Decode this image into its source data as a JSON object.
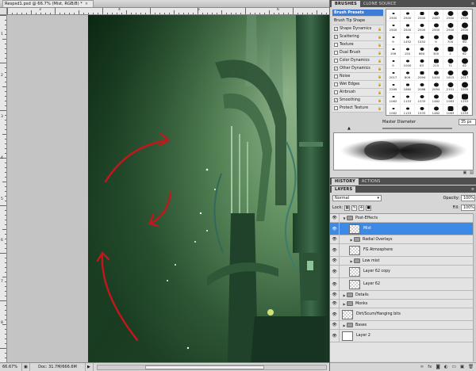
{
  "document": {
    "tab_title": "Respsd1.psd @ 66.7% (Mist, RGB/8) *",
    "close_glyph": "×",
    "ruler_top_labels": [
      "3",
      "4",
      "5",
      "6"
    ],
    "ruler_left_labels": [
      "1",
      "2",
      "3",
      "4",
      "5",
      "6",
      "7",
      "8"
    ],
    "status": {
      "zoom": "66.67%",
      "doc_size": "Doc: 31.7M/666.6M",
      "arrow_left": "◀",
      "arrow_right": "▶"
    }
  },
  "brushes_panel": {
    "tabs": [
      "BRUSHES",
      "CLONE SOURCE"
    ],
    "menu_glyph": "≡",
    "options": [
      {
        "label": "Brush Presets",
        "type": "preset"
      },
      {
        "label": "Brush Tip Shape",
        "type": "tip"
      },
      {
        "label": "Shape Dynamics",
        "checked": true
      },
      {
        "label": "Scattering",
        "checked": true
      },
      {
        "label": "Texture",
        "checked": false
      },
      {
        "label": "Dual Brush",
        "checked": false
      },
      {
        "label": "Color Dynamics",
        "checked": false
      },
      {
        "label": "Other Dynamics",
        "checked": true
      },
      {
        "label": "Noise",
        "checked": false
      },
      {
        "label": "Wet Edges",
        "checked": false
      },
      {
        "label": "Airbrush",
        "checked": false
      },
      {
        "label": "Smoothing",
        "checked": true
      },
      {
        "label": "Protect Texture",
        "checked": false
      }
    ],
    "preset_sizes": [
      "2500",
      "2500",
      "2500",
      "2467",
      "2500",
      "2500",
      "2500",
      "2500",
      "2500",
      "2500",
      "2500",
      "2500",
      "9",
      "1452",
      "1452",
      "9",
      "700",
      "60",
      "196",
      "150",
      "860",
      "300",
      "2",
      "62",
      "9",
      "1000",
      "63",
      "215",
      "71",
      "62",
      "2017",
      "806",
      "2094",
      "1404",
      "1815",
      "2017",
      "2269",
      "1860",
      "2086",
      "2094",
      "2101",
      "2205",
      "1062",
      "1153",
      "1533",
      "1482",
      "1063",
      "1253",
      "1062",
      "1153",
      "1533",
      "1482",
      "1063",
      "1253"
    ],
    "master_diameter_label": "Master Diameter",
    "master_diameter_value": "35 px"
  },
  "history_tabs": [
    "HISTORY",
    "ACTIONS"
  ],
  "layers_panel": {
    "tab": "LAYERS",
    "blend_mode": "Normal",
    "opacity_label": "Opacity:",
    "opacity_value": "100%",
    "lock_label": "Lock:",
    "fill_label": "Fill:",
    "fill_value": "100%",
    "layers": [
      {
        "name": "Post-Effects",
        "kind": "group",
        "depth": 0,
        "expanded": true
      },
      {
        "name": "Mist",
        "kind": "layer",
        "depth": 1,
        "selected": true
      },
      {
        "name": "Radial Overlays",
        "kind": "group",
        "depth": 1,
        "expanded": false
      },
      {
        "name": "FG Atmosphere",
        "kind": "layer",
        "depth": 1
      },
      {
        "name": "Low mist",
        "kind": "group",
        "depth": 1,
        "expanded": false
      },
      {
        "name": "Layer 62 copy",
        "kind": "layer",
        "depth": 1
      },
      {
        "name": "Layer 62",
        "kind": "layer",
        "depth": 1
      },
      {
        "name": "Details",
        "kind": "group",
        "depth": 0,
        "expanded": false
      },
      {
        "name": "Monks",
        "kind": "group",
        "depth": 0,
        "expanded": false
      },
      {
        "name": "Dirt/Scum/Hanging bits",
        "kind": "layer",
        "depth": 0
      },
      {
        "name": "Bases",
        "kind": "group",
        "depth": 0,
        "expanded": false
      },
      {
        "name": "Layer 2",
        "kind": "layer",
        "depth": 0,
        "white": true
      }
    ],
    "footer_icons": [
      "link-icon",
      "fx-icon",
      "mask-icon",
      "adjustment-icon",
      "new-group-icon",
      "new-layer-icon",
      "trash-icon"
    ],
    "footer_glyphs": [
      "∞",
      "fx",
      "◙",
      "◐",
      "▭",
      "▣",
      "🗑"
    ]
  },
  "colors": {
    "selection_blue": "#3d8ae6",
    "preset_blue": "#3d7cd9",
    "arrow_red": "#c4161c",
    "canvas_green_dark": "#0f3319",
    "canvas_green_light": "#9fc49c"
  }
}
